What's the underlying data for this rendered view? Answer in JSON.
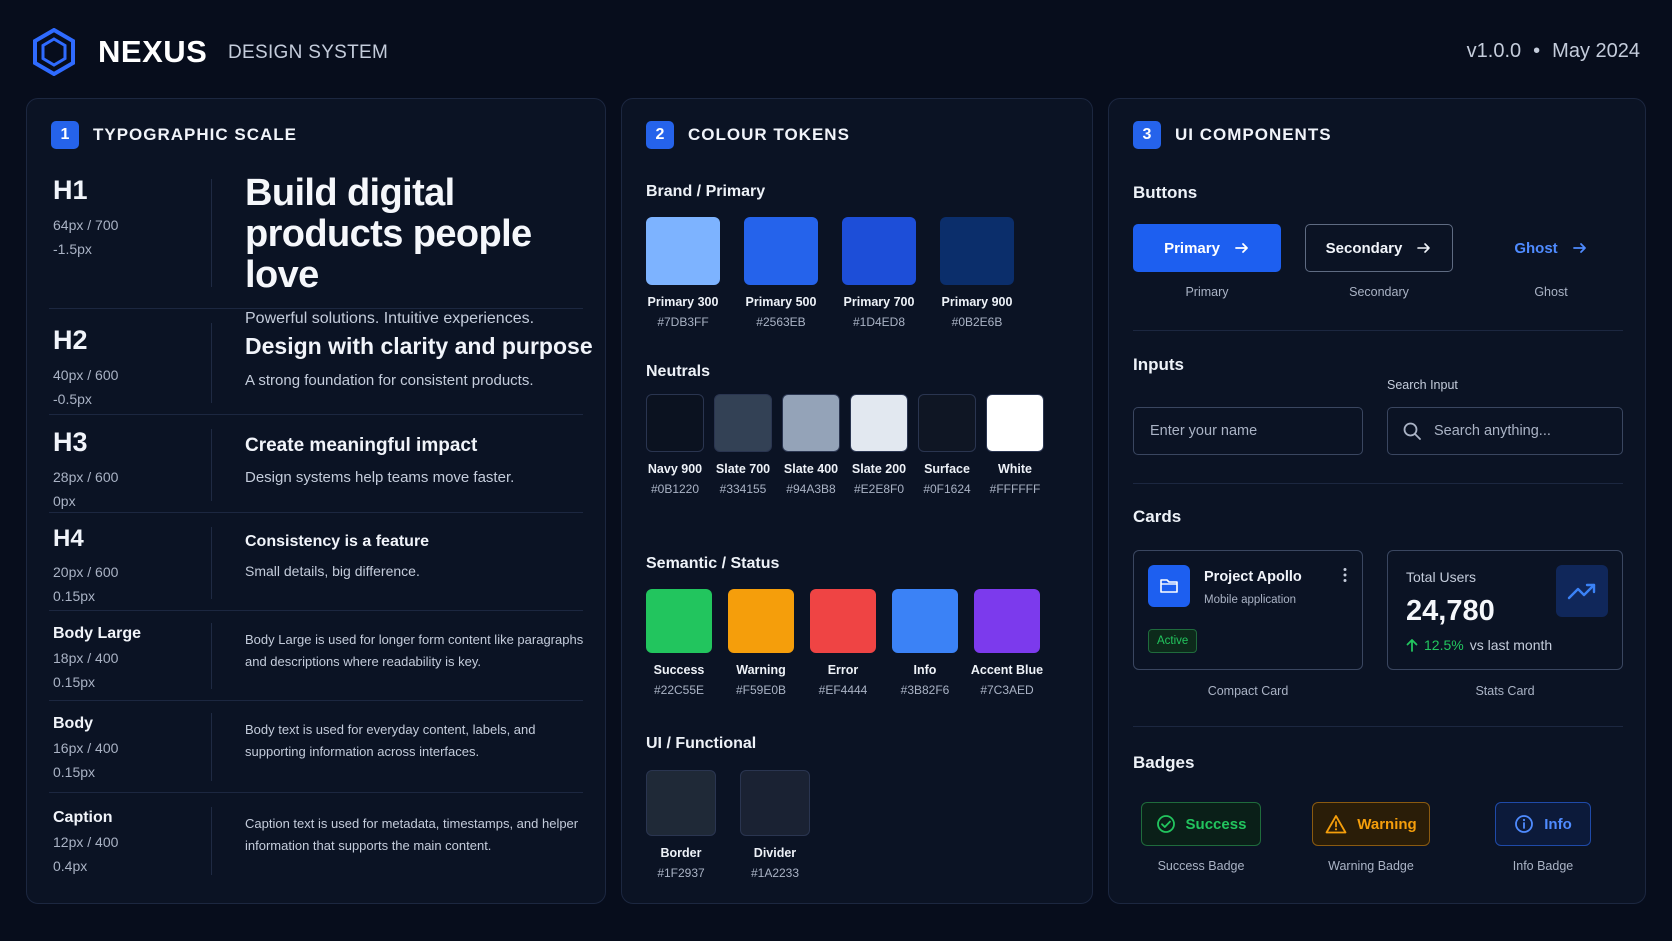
{
  "header": {
    "brand": "NEXUS",
    "subtitle": "DESIGN SYSTEM",
    "version": "v1.0.0",
    "separator": "•",
    "date": "May 2024"
  },
  "panels": {
    "typography": {
      "num": "1",
      "title": "TYPOGRAPHIC SCALE"
    },
    "colours": {
      "num": "2",
      "title": "COLOUR TOKENS"
    },
    "components": {
      "num": "3",
      "title": "UI COMPONENTS"
    }
  },
  "typography": [
    {
      "name": "H1",
      "size": "64px / 700",
      "tracking": "-1.5px",
      "sample": "Build digital products people love",
      "sub": "Powerful solutions. Intuitive experiences."
    },
    {
      "name": "H2",
      "size": "40px / 600",
      "tracking": "-0.5px",
      "sample": "Design with clarity and purpose",
      "sub": "A strong foundation for consistent products."
    },
    {
      "name": "H3",
      "size": "28px / 600",
      "tracking": "0px",
      "sample": "Create meaningful impact",
      "sub": "Design systems help teams move faster."
    },
    {
      "name": "H4",
      "size": "20px / 600",
      "tracking": "0.15px",
      "sample": "Consistency is a feature",
      "sub": "Small details, big difference."
    },
    {
      "name": "Body Large",
      "size": "18px / 400",
      "tracking": "0.15px",
      "sample": "Body Large is used for longer form content like paragraphs and descriptions where readability is key."
    },
    {
      "name": "Body",
      "size": "16px / 400",
      "tracking": "0.15px",
      "sample": "Body text is used for everyday content, labels, and supporting information across interfaces."
    },
    {
      "name": "Caption",
      "size": "12px / 400",
      "tracking": "0.4px",
      "sample": "Caption text is used for metadata, timestamps, and helper information that supports the main content."
    }
  ],
  "colours": {
    "brand_title": "Brand / Primary",
    "brand": [
      {
        "name": "Primary 300",
        "hex": "#7DB3FF"
      },
      {
        "name": "Primary 500",
        "hex": "#2563EB"
      },
      {
        "name": "Primary 700",
        "hex": "#1D4ED8"
      },
      {
        "name": "Primary 900",
        "hex": "#0B2E6B"
      }
    ],
    "neutrals_title": "Neutrals",
    "neutrals": [
      {
        "name": "Navy 900",
        "hex": "#0B1220"
      },
      {
        "name": "Slate 700",
        "hex": "#334155"
      },
      {
        "name": "Slate 400",
        "hex": "#94A3B8"
      },
      {
        "name": "Slate 200",
        "hex": "#E2E8F0"
      },
      {
        "name": "Surface",
        "hex": "#0F1624"
      },
      {
        "name": "White",
        "hex": "#FFFFFF"
      }
    ],
    "semantic_title": "Semantic / Status",
    "semantic": [
      {
        "name": "Success",
        "hex": "#22C55E"
      },
      {
        "name": "Warning",
        "hex": "#F59E0B"
      },
      {
        "name": "Error",
        "hex": "#EF4444"
      },
      {
        "name": "Info",
        "hex": "#3B82F6"
      },
      {
        "name": "Accent Blue",
        "hex": "#7C3AED"
      }
    ],
    "functional_title": "UI / Functional",
    "functional": [
      {
        "name": "Border",
        "hex": "#1F2937"
      },
      {
        "name": "Divider",
        "hex": "#1A2233"
      }
    ]
  },
  "components": {
    "buttons_title": "Buttons",
    "buttons": [
      {
        "label": "Primary",
        "caption": "Primary"
      },
      {
        "label": "Secondary",
        "caption": "Secondary"
      },
      {
        "label": "Ghost",
        "caption": "Ghost"
      }
    ],
    "inputs_title": "Inputs",
    "name_placeholder": "Enter your name",
    "search_label": "Search Input",
    "search_placeholder": "Search anything...",
    "cards_title": "Cards",
    "compact_card": {
      "title": "Project Apollo",
      "subtitle": "Mobile application",
      "status": "Active",
      "caption": "Compact Card"
    },
    "stats_card": {
      "label": "Total Users",
      "value": "24,780",
      "change": "12.5%",
      "change_note": "vs last month",
      "caption": "Stats Card"
    },
    "badges_title": "Badges",
    "badges": [
      {
        "label": "Success",
        "caption": "Success Badge"
      },
      {
        "label": "Warning",
        "caption": "Warning Badge"
      },
      {
        "label": "Info",
        "caption": "Info Badge"
      }
    ]
  },
  "icons": {
    "logo": "hexagon-logo-icon",
    "arrow": "arrow-right-icon",
    "search": "search-icon",
    "folder": "folder-icon",
    "more": "more-vertical-icon",
    "trend": "trending-up-icon",
    "up": "arrow-up-icon",
    "check": "check-circle-icon",
    "warning": "warning-triangle-icon",
    "info": "info-circle-icon"
  }
}
